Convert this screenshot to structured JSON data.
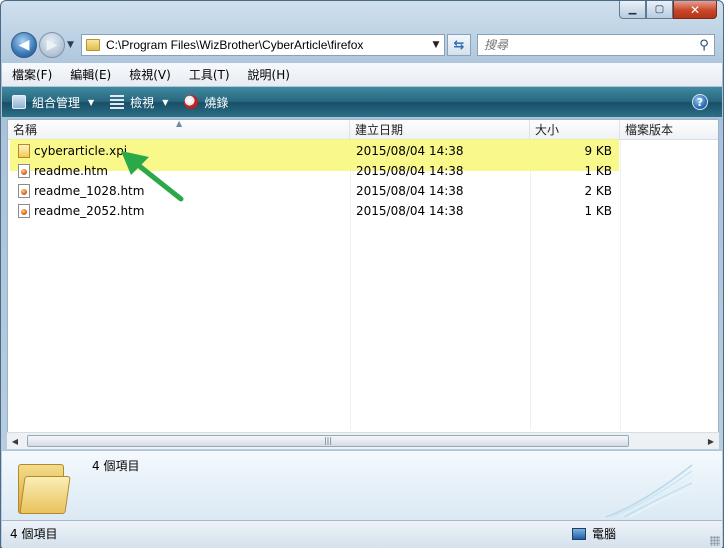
{
  "window": {
    "caption_buttons": [
      "minimize",
      "maximize",
      "close"
    ]
  },
  "address_bar": {
    "path": "C:\\Program Files\\WizBrother\\CyberArticle\\firefox"
  },
  "search": {
    "placeholder": "搜尋"
  },
  "menu": [
    "檔案(F)",
    "編輯(E)",
    "檢視(V)",
    "工具(T)",
    "說明(H)"
  ],
  "command_bar": {
    "organize": "組合管理",
    "views": "檢視",
    "burn": "燒錄"
  },
  "columns": {
    "name": "名稱",
    "date": "建立日期",
    "size": "大小",
    "version": "檔案版本"
  },
  "files": [
    {
      "name": "cyberarticle.xpi",
      "date": "2015/08/04 14:38",
      "size": "9 KB",
      "icon": "xpi-file-icon"
    },
    {
      "name": "readme.htm",
      "date": "2015/08/04 14:38",
      "size": "1 KB",
      "icon": "html-file-icon"
    },
    {
      "name": "readme_1028.htm",
      "date": "2015/08/04 14:38",
      "size": "2 KB",
      "icon": "html-file-icon"
    },
    {
      "name": "readme_2052.htm",
      "date": "2015/08/04 14:38",
      "size": "1 KB",
      "icon": "html-file-icon"
    }
  ],
  "details": {
    "count_text": "4 個項目"
  },
  "status_bar": {
    "left": "4 個項目",
    "right": "電腦"
  },
  "colors": {
    "highlight": "#f7f777",
    "arrow": "#2aa84a",
    "command_bar": "#28677f"
  }
}
